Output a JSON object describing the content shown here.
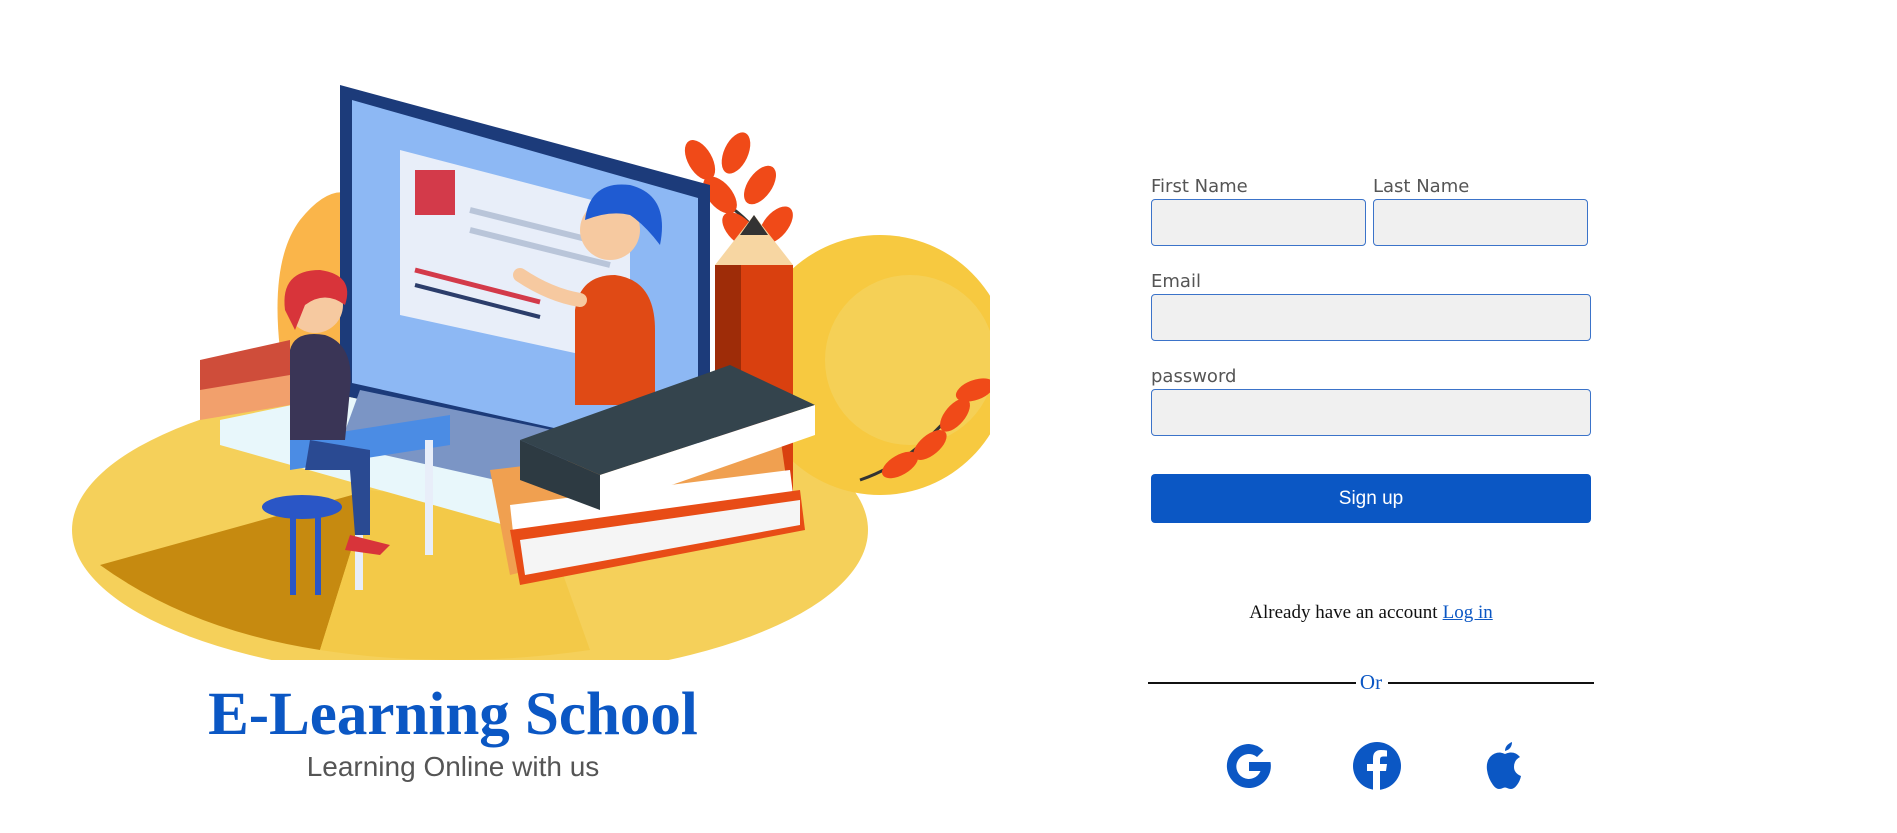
{
  "brand": {
    "title": "E-Learning School",
    "subtitle": "Learning Online with us"
  },
  "form": {
    "first_name_label": "First Name",
    "first_name_value": "",
    "last_name_label": "Last Name",
    "last_name_value": "",
    "email_label": "Email",
    "email_value": "",
    "password_label": "password",
    "password_value": "",
    "signup_label": "Sign up"
  },
  "account": {
    "prompt": "Already have an account",
    "login_link": "Log in"
  },
  "divider": {
    "text": "Or"
  },
  "social": [
    {
      "icon": "google-icon"
    },
    {
      "icon": "facebook-icon"
    },
    {
      "icon": "apple-icon"
    }
  ],
  "hero": {
    "illustration": "e-learning-illustration"
  },
  "colors": {
    "brand_blue": "#0b57c4",
    "field_bg": "#f0f0f0",
    "field_border": "#3b73c9",
    "subtitle_gray": "#555555"
  }
}
